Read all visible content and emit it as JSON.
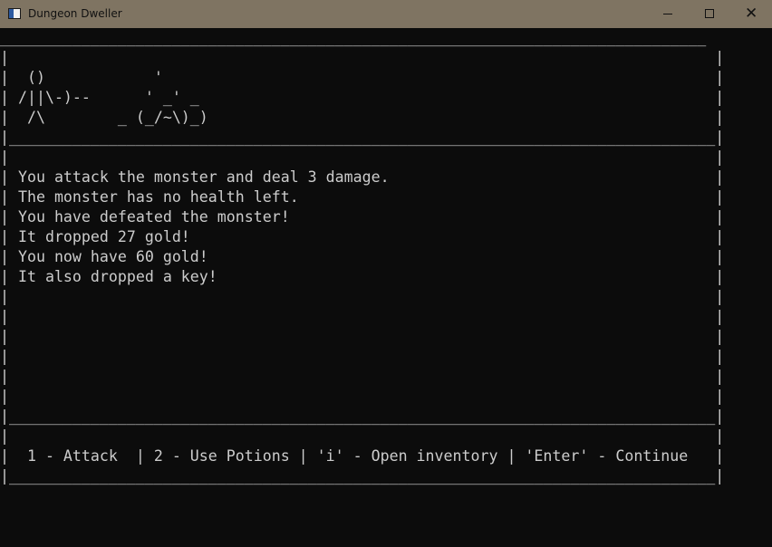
{
  "window": {
    "title": "Dungeon Dweller",
    "icon": "console-window-icon",
    "controls": {
      "minimize": "minimize-icon",
      "maximize": "maximize-icon",
      "close": "close-icon",
      "close_glyph": "✕"
    }
  },
  "console": {
    "top_border": "______________________________________________________________________________",
    "art_lines": [
      "|                                                                              |",
      "|  ()            '                                                             |",
      "| /||\\-)--      ' _' _                                                         |",
      "|  /\\        _ (_/~\\)_)                                                        |",
      "|______________________________________________________________________________|"
    ],
    "message_lines": [
      "|                                                                              |",
      "| You attack the monster and deal 3 damage.                                    |",
      "| The monster has no health left.                                              |",
      "| You have defeated the monster!                                               |",
      "| It dropped 27 gold!                                                          |",
      "| You now have 60 gold!                                                        |",
      "| It also dropped a key!                                                       |",
      "|                                                                              |",
      "|                                                                              |",
      "|                                                                              |",
      "|                                                                              |",
      "|                                                                              |",
      "|                                                                              |",
      "|______________________________________________________________________________|"
    ],
    "menu_lines": [
      "|                                                                              |",
      "|  1 - Attack  | 2 - Use Potions | 'i' - Open inventory | 'Enter' - Continue   |",
      "|______________________________________________________________________________|"
    ]
  },
  "colors": {
    "titlebar_bg": "#7f7462",
    "console_bg": "#0c0c0c",
    "console_fg": "#cccccc"
  }
}
